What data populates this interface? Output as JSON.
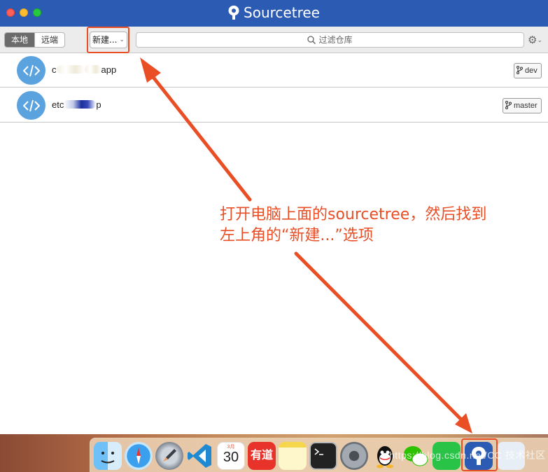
{
  "window": {
    "title": "Sourcetree",
    "colors": {
      "titlebar": "#2c5bb3",
      "accent": "#5ba3df",
      "annotation": "#e94e25"
    }
  },
  "toolbar": {
    "segment_local": "本地",
    "segment_remote": "远端",
    "new_button": "新建...",
    "search_placeholder": "过滤仓库",
    "settings_icon": "gear-icon"
  },
  "repos": [
    {
      "name_prefix": "c",
      "name_suffix": "app",
      "branch": "dev",
      "icon": "code-icon"
    },
    {
      "name_prefix": "etc",
      "name_suffix": "p",
      "branch": "master",
      "icon": "code-icon"
    }
  ],
  "annotation": {
    "line1": "打开电脑上面的sourcetree，然后找到",
    "line2": "左上角的“新建...”选项"
  },
  "dock": {
    "calendar_month": "3月",
    "calendar_day": "30",
    "youdao_label": "有道",
    "items": [
      "finder-icon",
      "safari-icon",
      "launchpad-icon",
      "vscode-icon",
      "calendar-icon",
      "youdao-icon",
      "notes-icon",
      "terminal-icon",
      "system-preferences-icon",
      "qq-icon",
      "wechat-icon",
      "iqiyi-icon",
      "sourcetree-icon",
      "preview-icon"
    ]
  },
  "watermark": "https://blog.csdn.net/CC 技术社区"
}
